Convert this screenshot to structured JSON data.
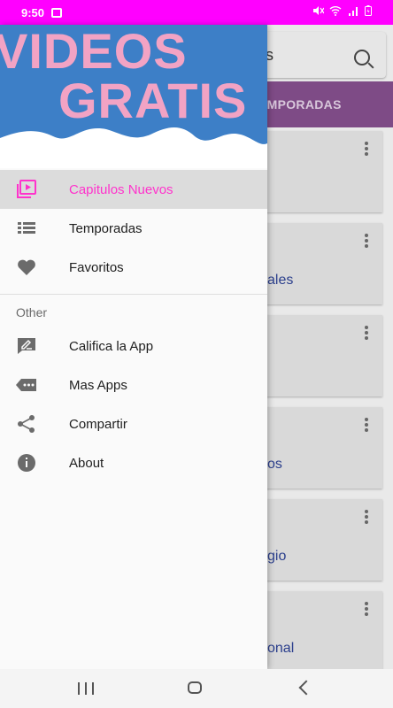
{
  "status_bar": {
    "time": "9:50"
  },
  "background_app": {
    "search_text": "s",
    "tab_label": "EMPORADAS",
    "cards": [
      {
        "title": ""
      },
      {
        "title": "ales"
      },
      {
        "title": ""
      },
      {
        "title": "os"
      },
      {
        "title": "gio"
      },
      {
        "title": "onal"
      }
    ]
  },
  "drawer": {
    "header": {
      "line1": "VIDEOS",
      "line2": "GRATIS"
    },
    "items": [
      {
        "label": "Capitulos Nuevos",
        "icon": "video-playlist-icon",
        "active": true
      },
      {
        "label": "Temporadas",
        "icon": "list-icon"
      },
      {
        "label": "Favoritos",
        "icon": "heart-icon"
      }
    ],
    "section_title": "Other",
    "other_items": [
      {
        "label": "Califica la App",
        "icon": "rate-review-icon"
      },
      {
        "label": "Mas Apps",
        "icon": "more-apps-icon"
      },
      {
        "label": "Compartir",
        "icon": "share-icon"
      },
      {
        "label": "About",
        "icon": "info-icon"
      }
    ]
  },
  "colors": {
    "status_bar": "#ff00ff",
    "accent": "#ff33cc",
    "tabbar": "#7e4b86"
  }
}
